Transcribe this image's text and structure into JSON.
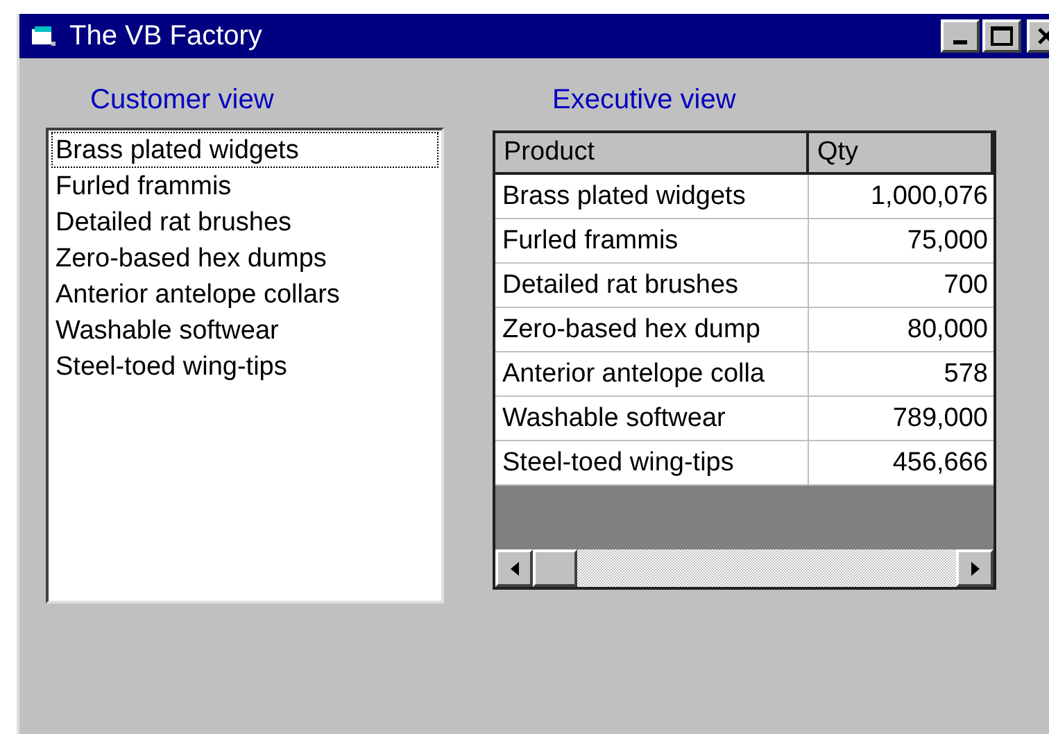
{
  "window": {
    "title": "The VB Factory"
  },
  "customer_view": {
    "label": "Customer view",
    "items": [
      {
        "text": "Brass plated widgets",
        "selected": true
      },
      {
        "text": "Furled frammis",
        "selected": false
      },
      {
        "text": "Detailed rat brushes",
        "selected": false
      },
      {
        "text": "Zero-based hex dumps",
        "selected": false
      },
      {
        "text": "Anterior antelope collars",
        "selected": false
      },
      {
        "text": "Washable softwear",
        "selected": false
      },
      {
        "text": "Steel-toed wing-tips",
        "selected": false
      }
    ]
  },
  "executive_view": {
    "label": "Executive view",
    "columns": [
      "Product",
      "Qty"
    ],
    "rows": [
      [
        "Brass plated widgets",
        "1,000,076"
      ],
      [
        "Furled frammis",
        "75,000"
      ],
      [
        "Detailed rat brushes",
        "700"
      ],
      [
        "Zero-based hex dump",
        "80,000"
      ],
      [
        "Anterior antelope colla",
        "578"
      ],
      [
        "Washable softwear",
        "789,000"
      ],
      [
        "Steel-toed wing-tips",
        "456,666"
      ]
    ]
  }
}
